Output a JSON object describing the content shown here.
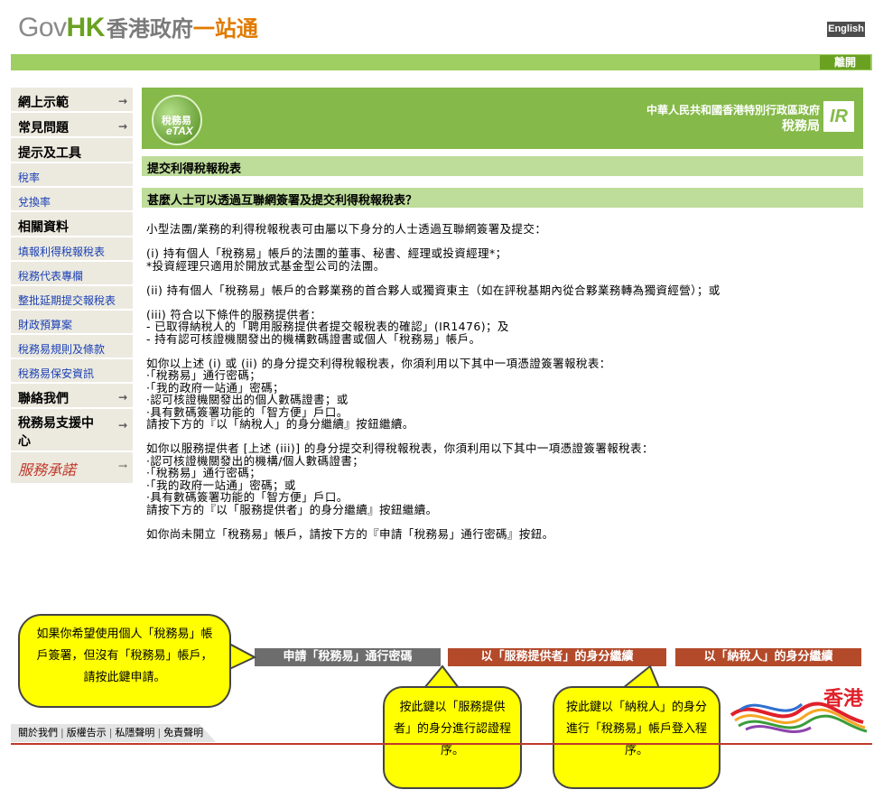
{
  "header": {
    "logo_gov": "Gov",
    "logo_hk": "HK",
    "logo_zh_part1": "香港政府",
    "logo_zh_part2": "一站通",
    "language_button": "English",
    "exit_button": "離開"
  },
  "sidebar": {
    "items": [
      {
        "label": "網上示範",
        "type": "main",
        "arrow": true
      },
      {
        "label": "常見問題",
        "type": "main",
        "arrow": true
      },
      {
        "label": "提示及工具",
        "type": "main",
        "arrow": false
      },
      {
        "label": "稅率",
        "type": "sub"
      },
      {
        "label": "兌換率",
        "type": "sub"
      },
      {
        "label": "相關資料",
        "type": "main",
        "arrow": false
      },
      {
        "label": "填報利得稅報稅表",
        "type": "sub"
      },
      {
        "label": "稅務代表專欄",
        "type": "sub"
      },
      {
        "label": "整批延期提交報稅表",
        "type": "sub"
      },
      {
        "label": "財政預算案",
        "type": "sub"
      },
      {
        "label": "稅務易規則及條款",
        "type": "sub"
      },
      {
        "label": "稅務易保安資訊",
        "type": "sub"
      },
      {
        "label": "聯絡我們",
        "type": "main",
        "arrow": true
      },
      {
        "label": "稅務易支援中心",
        "type": "tall",
        "arrow": true
      },
      {
        "label": "服務承諾",
        "type": "brand",
        "arrow": true
      }
    ]
  },
  "banner": {
    "etax_zh": "稅務易",
    "etax_en": "eTAX",
    "gov_line1": "中華人民共和國香港特別行政區政府",
    "gov_line2": "稅務局",
    "ird_logo": "IR"
  },
  "page_title": "提交利得稅報稅表",
  "section_title": "甚麼人士可以透過互聯網簽署及提交利得稅報稅表？",
  "content": {
    "paragraphs": [
      "小型法團/業務的利得稅報稅表可由屬以下身分的人士透過互聯網簽署及提交：",
      "(i) 持有個人「稅務易」帳戶的法團的董事、秘書、經理或投資經理*；\n*投資經理只適用於開放式基金型公司的法團。",
      "(ii) 持有個人「稅務易」帳戶的合夥業務的首合夥人或獨資東主（如在評稅基期內從合夥業務轉為獨資經營）；或",
      "(iii) 符合以下條件的服務提供者：\n- 已取得納稅人的「聘用服務提供者提交報稅表的確認」(IR1476)；及\n- 持有認可核證機關發出的機構數碼證書或個人「稅務易」帳戶。",
      "如你以上述 (i) 或 (ii) 的身分提交利得稅報稅表，你須利用以下其中一項憑證簽署報稅表：\n·「稅務易」通行密碼；\n·「我的政府一站通」密碼；\n·認可核證機關發出的個人數碼證書；或\n·具有數碼簽署功能的「智方便」戶口。\n請按下方的『以「納稅人」的身分繼續』按鈕繼續。",
      "如你以服務提供者 [上述 (iii)] 的身分提交利得稅報稅表，你須利用以下其中一項憑證簽署報稅表：\n·認可核證機關發出的機構/個人數碼證書；\n·「稅務易」通行密碼；\n·「我的政府一站通」密碼；或\n·具有數碼簽署功能的「智方便」戶口。\n請按下方的『以「服務提供者」的身分繼續』按鈕繼續。",
      "如你尚未開立「稅務易」帳戶，請按下方的『申請「稅務易」通行密碼』按鈕。"
    ]
  },
  "buttons": {
    "apply_password": "申請「稅務易」通行密碼",
    "continue_service_provider": "以「服務提供者」的身分繼續",
    "continue_taxpayer": "以「納稅人」的身分繼續"
  },
  "callouts": {
    "apply": "如果你希望使用個人「稅務易」帳戶簽署，但沒有「稅務易」帳戶，請按此鍵申請。",
    "service_provider": "按此鍵以「服務提供者」的身分進行認證程序。",
    "taxpayer": "按此鍵以「納稅人」的身分進行「稅務易」帳戶登入程序。"
  },
  "footer": {
    "links": [
      "關於我們",
      "版權告示",
      "私隱聲明",
      "免責聲明"
    ],
    "brand_zh": "香港"
  },
  "colors": {
    "green_bar": "#9fce63",
    "banner_green": "#85b949",
    "section_green": "#bedc9a",
    "button_red": "#b34a2a",
    "callout_yellow": "#ffff00"
  }
}
